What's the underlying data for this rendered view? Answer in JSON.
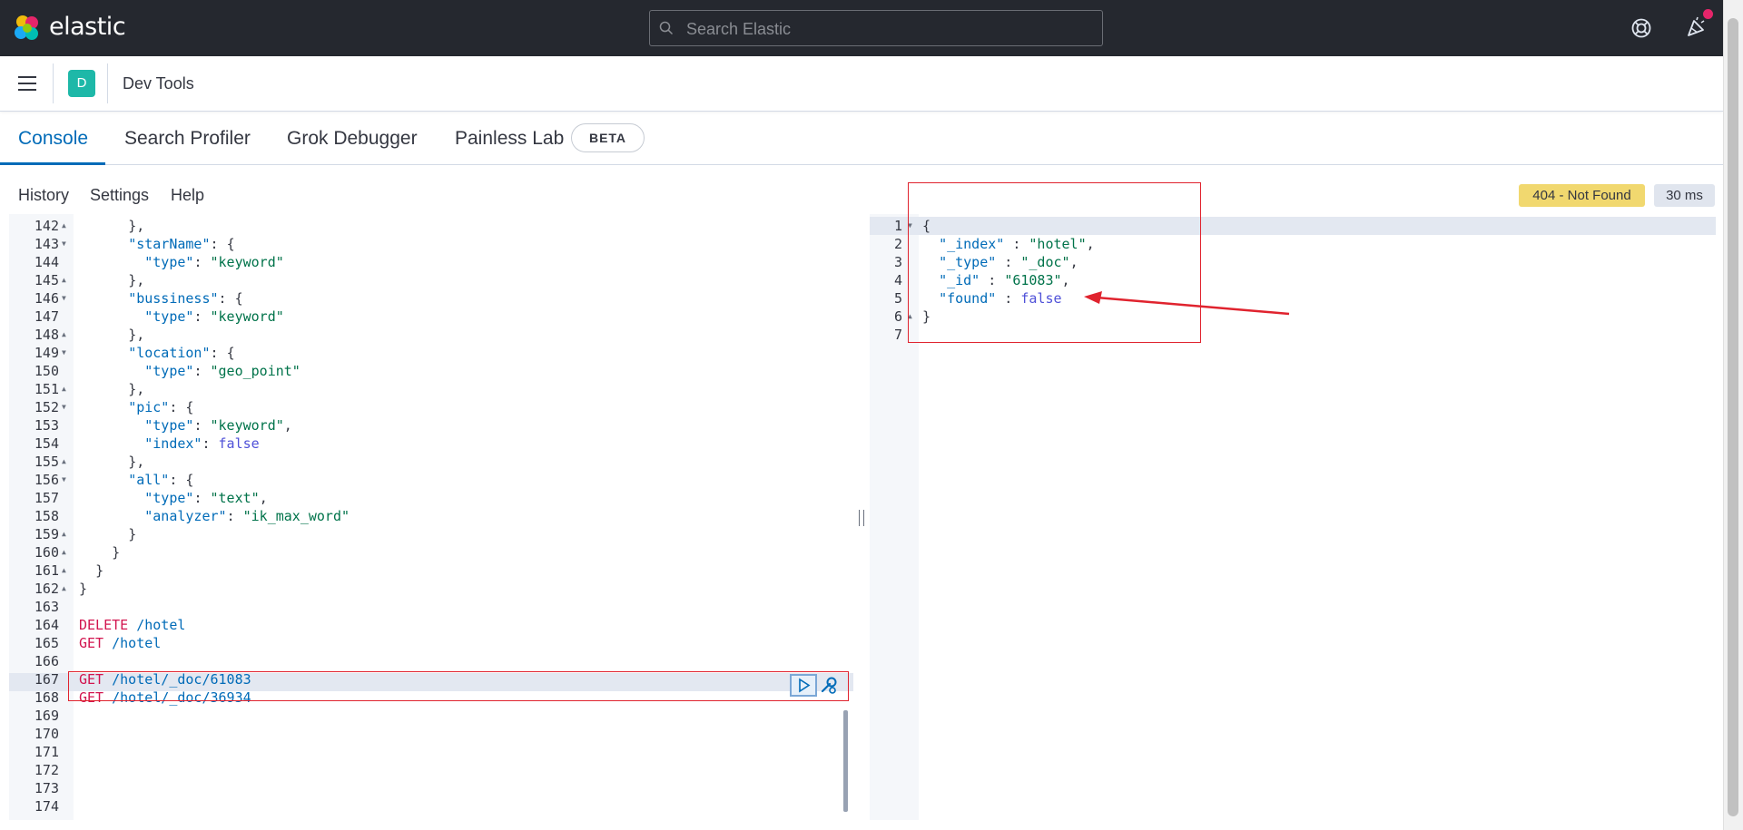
{
  "header": {
    "brand": "elastic",
    "search_placeholder": "Search Elastic",
    "colors": {
      "bg": "#25282f",
      "notification_dot": "#e5256a"
    }
  },
  "breadcrumbs": {
    "avatar_letter": "D",
    "title": "Dev Tools"
  },
  "tabs": [
    {
      "label": "Console",
      "active": true
    },
    {
      "label": "Search Profiler"
    },
    {
      "label": "Grok Debugger"
    },
    {
      "label": "Painless Lab"
    }
  ],
  "beta_badge": "BETA",
  "console_menu": {
    "history": "History",
    "settings": "Settings",
    "help": "Help"
  },
  "response_status": "404 - Not Found",
  "response_time": "30 ms",
  "request_editor": {
    "line_numbers": [
      "142",
      "143",
      "144",
      "145",
      "146",
      "147",
      "148",
      "149",
      "150",
      "151",
      "152",
      "153",
      "154",
      "155",
      "156",
      "157",
      "158",
      "159",
      "160",
      "161",
      "162",
      "163",
      "164",
      "165",
      "166",
      "167",
      "168",
      "169",
      "170",
      "171",
      "172",
      "173",
      "174"
    ],
    "lines": [
      "      },",
      "      \"starName\": {",
      "        \"type\": \"keyword\"",
      "      },",
      "      \"bussiness\": {",
      "        \"type\": \"keyword\"",
      "      },",
      "      \"location\": {",
      "        \"type\": \"geo_point\"",
      "      },",
      "      \"pic\": {",
      "        \"type\": \"keyword\",",
      "        \"index\": false",
      "      },",
      "      \"all\": {",
      "        \"type\": \"text\",",
      "        \"analyzer\": \"ik_max_word\"",
      "      }",
      "    }",
      "  }",
      "}",
      "",
      "DELETE /hotel",
      "GET /hotel",
      "",
      "GET /hotel/_doc/61083",
      "GET /hotel/_doc/36934",
      "",
      "",
      "",
      "",
      "",
      ""
    ]
  },
  "response_editor": {
    "line_numbers": [
      "1",
      "2",
      "3",
      "4",
      "5",
      "6",
      "7"
    ],
    "lines": [
      "{",
      "  \"_index\" : \"hotel\",",
      "  \"_type\" : \"_doc\",",
      "  \"_id\" : \"61083\",",
      "  \"found\" : false",
      "}",
      ""
    ]
  }
}
